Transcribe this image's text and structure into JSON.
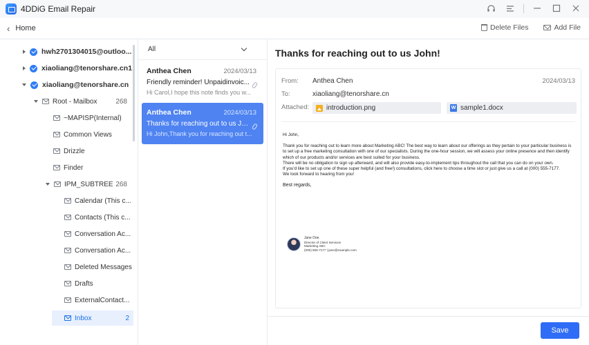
{
  "window": {
    "title": "4DDiG Email Repair"
  },
  "toolbar": {
    "back_label": "Home",
    "delete_label": "Delete Files",
    "add_label": "Add File"
  },
  "tree": {
    "accounts": [
      {
        "name": "hwh2701304015@outloo...",
        "expanded": false
      },
      {
        "name": "xiaoliang@tenorshare.cn1",
        "expanded": false
      },
      {
        "name": "xiaoliang@tenorshare.cn",
        "expanded": true
      }
    ],
    "folders": [
      {
        "label": "Root - Mailbox",
        "count": "268",
        "level": 1,
        "caret": true
      },
      {
        "label": "~MAPISP(Internal)",
        "count": "",
        "level": 2,
        "caret": false
      },
      {
        "label": "Common Views",
        "count": "",
        "level": 2,
        "caret": false
      },
      {
        "label": "Drizzle",
        "count": "",
        "level": 2,
        "caret": false
      },
      {
        "label": "Finder",
        "count": "",
        "level": 2,
        "caret": false
      },
      {
        "label": "IPM_SUBTREE",
        "count": "268",
        "level": 2,
        "caret": true
      },
      {
        "label": "Calendar (This c...",
        "count": "",
        "level": 3,
        "caret": false
      },
      {
        "label": "Contacts (This c...",
        "count": "",
        "level": 3,
        "caret": false
      },
      {
        "label": "Conversation Ac...",
        "count": "",
        "level": 3,
        "caret": false
      },
      {
        "label": "Conversation Ac...",
        "count": "",
        "level": 3,
        "caret": false
      },
      {
        "label": "Deleted Messages",
        "count": "",
        "level": 3,
        "caret": false
      },
      {
        "label": "Drafts",
        "count": "",
        "level": 3,
        "caret": false
      },
      {
        "label": "ExternalContact...",
        "count": "",
        "level": 3,
        "caret": false
      },
      {
        "label": "Inbox",
        "count": "2",
        "level": 3,
        "caret": false,
        "selected": true
      }
    ]
  },
  "list": {
    "filter": "All",
    "mails": [
      {
        "sender": "Anthea Chen",
        "date": "2024/03/13",
        "subject": "Friendly reminder! Unpaidinvoic...",
        "preview": "Hi Carol,I hope this note finds you w...",
        "selected": false
      },
      {
        "sender": "Anthea Chen",
        "date": "2024/03/13",
        "subject": "Thanks for reaching out to us Jo...",
        "preview": "Hi John,Thank you for reaching out t...",
        "selected": true
      }
    ]
  },
  "reader": {
    "subject": "Thanks for reaching out to us John!",
    "from_label": "From:",
    "from": "Anthea Chen",
    "date": "2024/03/13",
    "to_label": "To:",
    "to": "xiaoliang@tenorshare.cn",
    "attached_label": "Attached:",
    "attachments": [
      "introduction.png",
      "sample1.docx"
    ],
    "body": {
      "greeting": "Hi John,",
      "p1": "Thank you for reaching out to learn more about Marketing ABC! The best way to learn about our offerings as they pertain to your particular business is to set up a free marketing consultation with one of our specialists. During the one-hour session, we will assess your online presence and then identify which of our products and/or services are best suited for your business.",
      "p2": "There will be no obligation to sign up afterward, and will also provide easy-to-implement tips throughout the call that you can do on your own.",
      "p3": "If you'd like to set up one of these super helpful (and free!) consultations, click here to choose a time slot or just give us a call at (000) 555-7177.",
      "p4": "We look forward to hearing from you!",
      "closing": "Best regards,",
      "sig_name": "Jane Doe",
      "sig_title": "Director of Client Services",
      "sig_company": "Marketing ABC",
      "sig_contact": "(000) 555-7177 | jane@example.com"
    }
  },
  "footer": {
    "save_label": "Save"
  },
  "colors": {
    "accent": "#2f6df6",
    "selected_mail": "#4e83f1",
    "selected_folder_bg": "#e8f0fe"
  }
}
